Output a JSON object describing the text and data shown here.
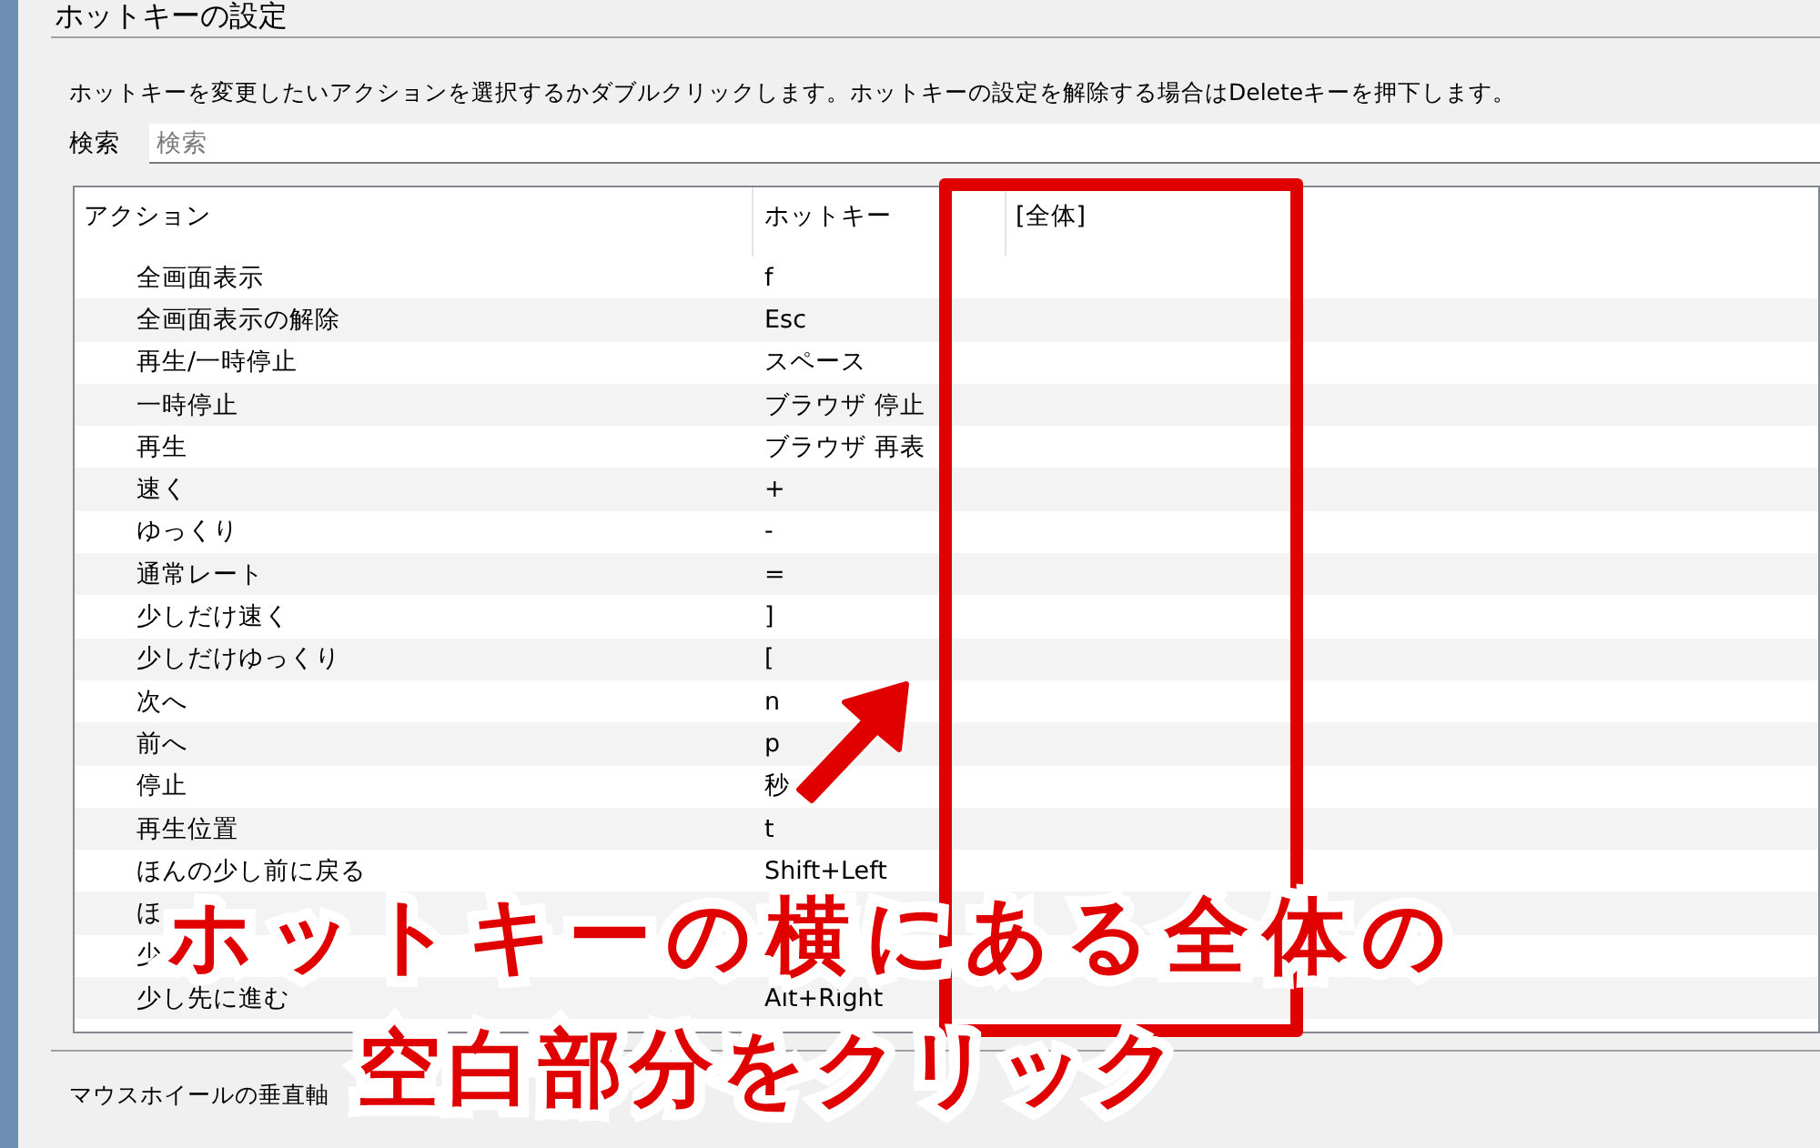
{
  "dialog": {
    "title": "ホットキーの設定",
    "instruction": "ホットキーを変更したいアクションを選択するかダブルクリックします。ホットキーの設定を解除する場合はDeleteキーを押下します。",
    "search": {
      "label": "検索",
      "placeholder": "検索"
    },
    "table": {
      "columns": [
        "アクション",
        "ホットキー",
        "[全体]"
      ],
      "rows": [
        {
          "action": "全画面表示",
          "hotkey": "f"
        },
        {
          "action": "全画面表示の解除",
          "hotkey": "Esc"
        },
        {
          "action": "再生/一時停止",
          "hotkey": "スペース"
        },
        {
          "action": "一時停止",
          "hotkey": "ブラウザ 停止"
        },
        {
          "action": "再生",
          "hotkey": "ブラウザ 再表"
        },
        {
          "action": "速く",
          "hotkey": "+"
        },
        {
          "action": "ゆっくり",
          "hotkey": "-"
        },
        {
          "action": "通常レート",
          "hotkey": "="
        },
        {
          "action": "少しだけ速く",
          "hotkey": "]"
        },
        {
          "action": "少しだけゆっくり",
          "hotkey": "["
        },
        {
          "action": "次へ",
          "hotkey": "n"
        },
        {
          "action": "前へ",
          "hotkey": "p"
        },
        {
          "action": "停止",
          "hotkey": "秒"
        },
        {
          "action": "再生位置",
          "hotkey": "t"
        },
        {
          "action": "ほんの少し前に戻る",
          "hotkey": "Shift+Left"
        },
        {
          "action": "ほ",
          "hotkey": ""
        },
        {
          "action": "少",
          "hotkey": ""
        },
        {
          "action": "少し先に進む",
          "hotkey": "Alt+Right"
        }
      ]
    },
    "footer_label": "マウスホイールの垂直軸"
  },
  "annotation": {
    "caption_lines": [
      "ホットキーの横にある全体の",
      "空白部分をクリック"
    ]
  }
}
